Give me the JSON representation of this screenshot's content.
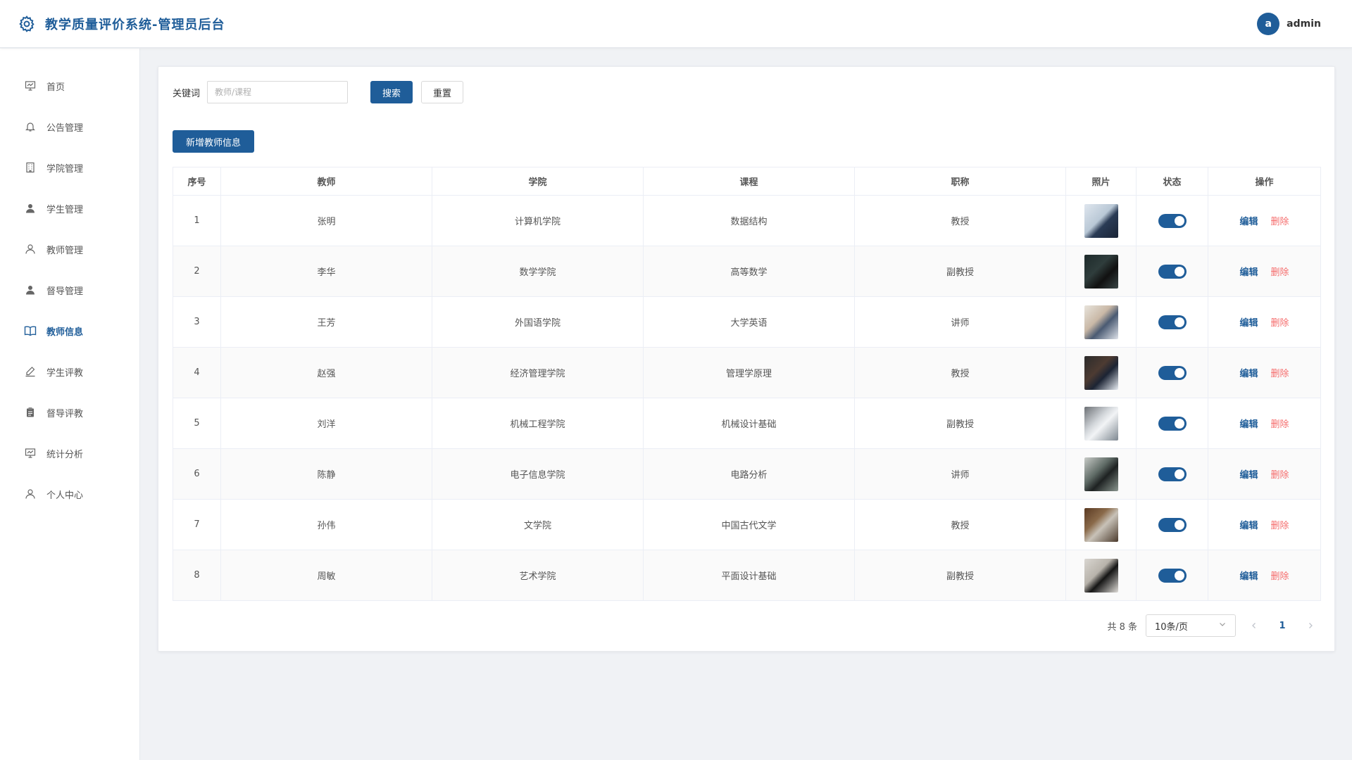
{
  "header": {
    "title": "教学质量评价系统-管理员后台",
    "brand_icon": "gear-icon",
    "user": {
      "avatar_letter": "a",
      "name": "admin"
    }
  },
  "sidebar": {
    "items": [
      {
        "label": "首页",
        "icon": "presentation-icon",
        "active": false
      },
      {
        "label": "公告管理",
        "icon": "bell-icon",
        "active": false
      },
      {
        "label": "学院管理",
        "icon": "building-icon",
        "active": false
      },
      {
        "label": "学生管理",
        "icon": "user-filled-icon",
        "active": false
      },
      {
        "label": "教师管理",
        "icon": "user-outline-icon",
        "active": false
      },
      {
        "label": "督导管理",
        "icon": "user-filled-icon",
        "active": false
      },
      {
        "label": "教师信息",
        "icon": "book-icon",
        "active": true
      },
      {
        "label": "学生评教",
        "icon": "pen-icon",
        "active": false
      },
      {
        "label": "督导评教",
        "icon": "clipboard-icon",
        "active": false
      },
      {
        "label": "统计分析",
        "icon": "presentation-icon",
        "active": false
      },
      {
        "label": "个人中心",
        "icon": "user-outline-icon",
        "active": false
      }
    ]
  },
  "search": {
    "label": "关键词",
    "placeholder": "教师/课程",
    "value": "",
    "search_button": "搜索",
    "reset_button": "重置"
  },
  "actions": {
    "add_button": "新增教师信息"
  },
  "table": {
    "columns": [
      "序号",
      "教师",
      "学院",
      "课程",
      "职称",
      "照片",
      "状态",
      "操作"
    ],
    "rows": [
      {
        "index": "1",
        "teacher": "张明",
        "college": "计算机学院",
        "course": "数据结构",
        "title": "教授",
        "status": true,
        "edit": "编辑",
        "delete": "删除"
      },
      {
        "index": "2",
        "teacher": "李华",
        "college": "数学学院",
        "course": "高等数学",
        "title": "副教授",
        "status": true,
        "edit": "编辑",
        "delete": "删除"
      },
      {
        "index": "3",
        "teacher": "王芳",
        "college": "外国语学院",
        "course": "大学英语",
        "title": "讲师",
        "status": true,
        "edit": "编辑",
        "delete": "删除"
      },
      {
        "index": "4",
        "teacher": "赵强",
        "college": "经济管理学院",
        "course": "管理学原理",
        "title": "教授",
        "status": true,
        "edit": "编辑",
        "delete": "删除"
      },
      {
        "index": "5",
        "teacher": "刘洋",
        "college": "机械工程学院",
        "course": "机械设计基础",
        "title": "副教授",
        "status": true,
        "edit": "编辑",
        "delete": "删除"
      },
      {
        "index": "6",
        "teacher": "陈静",
        "college": "电子信息学院",
        "course": "电路分析",
        "title": "讲师",
        "status": true,
        "edit": "编辑",
        "delete": "删除"
      },
      {
        "index": "7",
        "teacher": "孙伟",
        "college": "文学院",
        "course": "中国古代文学",
        "title": "教授",
        "status": true,
        "edit": "编辑",
        "delete": "删除"
      },
      {
        "index": "8",
        "teacher": "周敏",
        "college": "艺术学院",
        "course": "平面设计基础",
        "title": "副教授",
        "status": true,
        "edit": "编辑",
        "delete": "删除"
      }
    ]
  },
  "pagination": {
    "total_text": "共 8 条",
    "page_size": "10条/页",
    "current_page": "1"
  },
  "colors": {
    "primary": "#1f5d99",
    "danger": "#f56c6c",
    "background": "#f0f2f5"
  }
}
